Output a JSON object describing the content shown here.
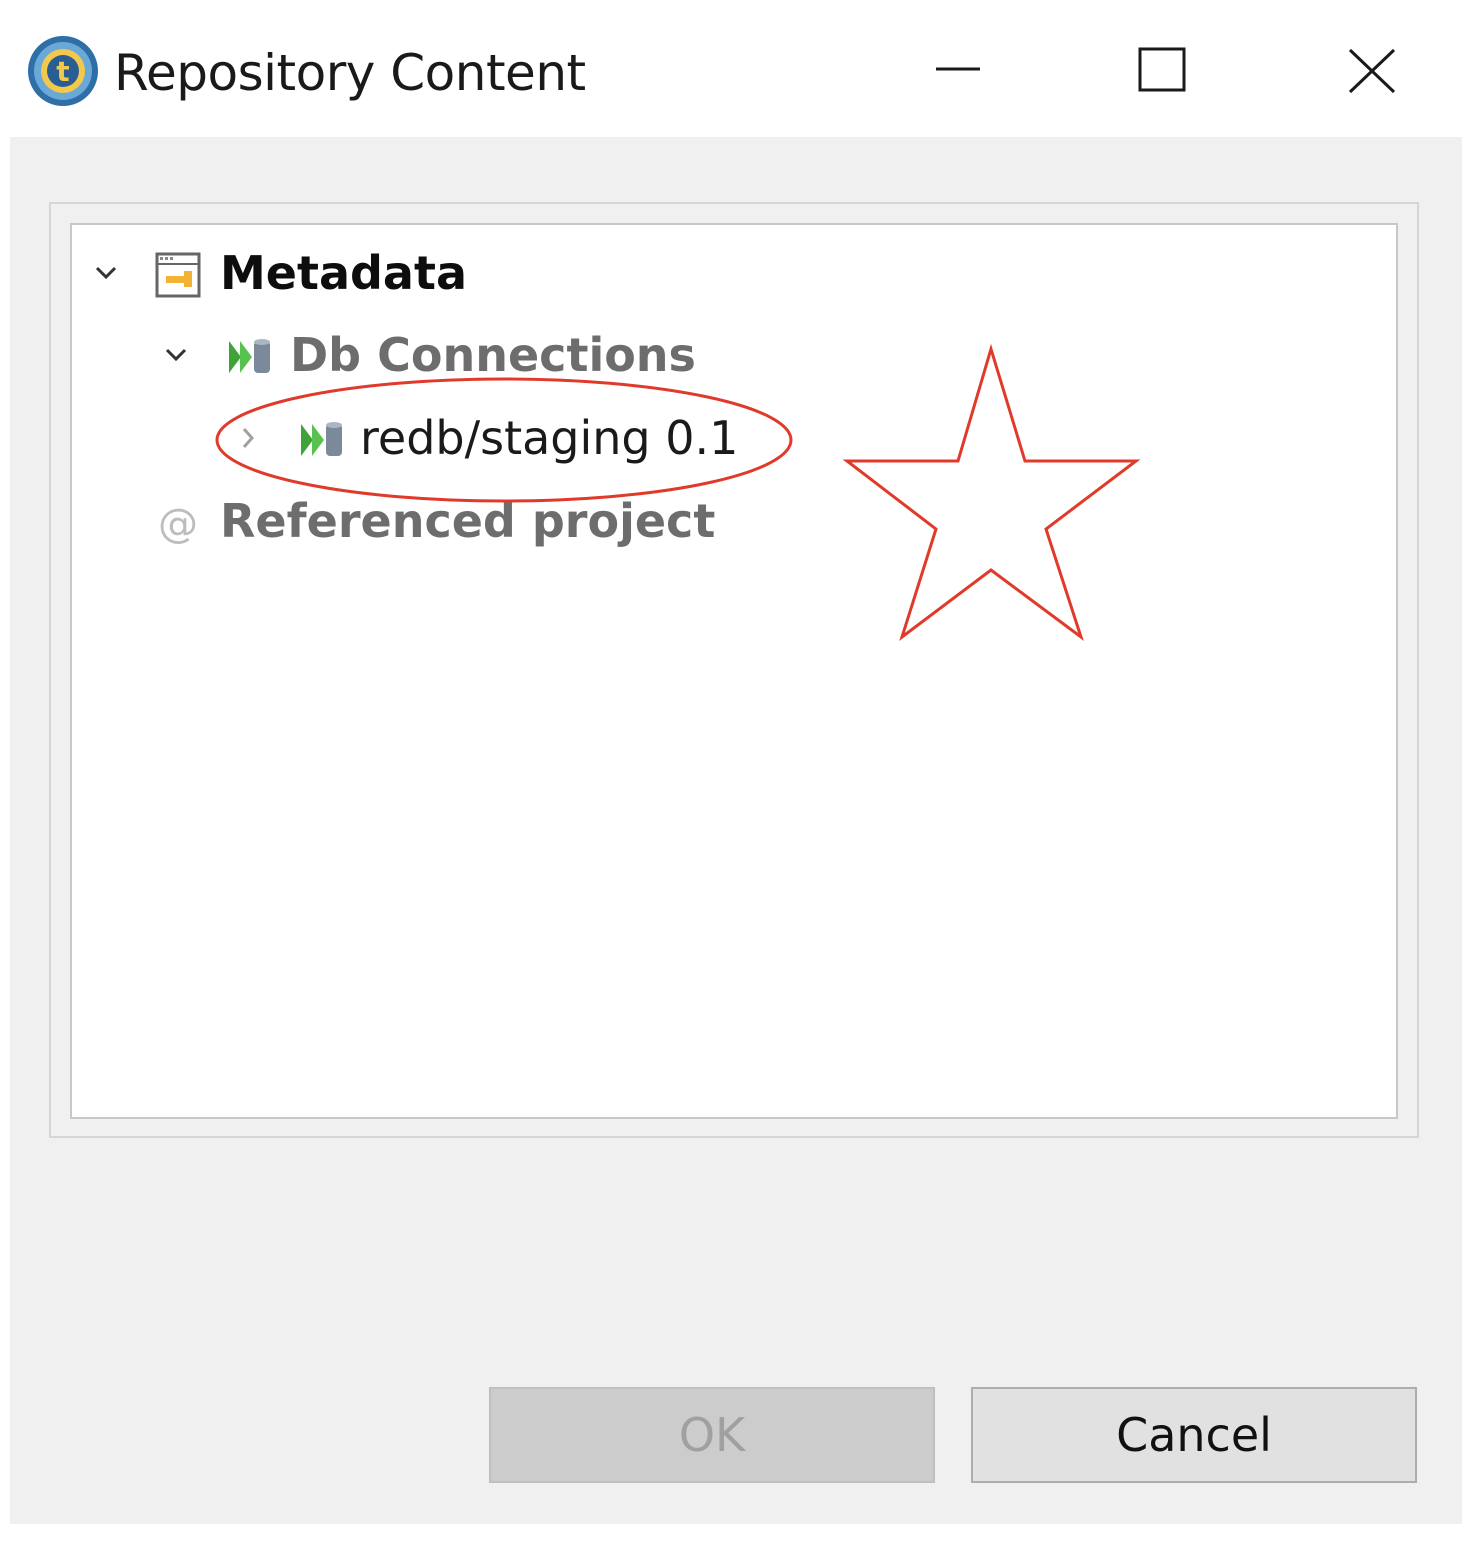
{
  "window": {
    "title": "Repository Content",
    "controls": {
      "minimize": "minimize-icon",
      "maximize": "maximize-icon",
      "close": "close-icon"
    },
    "app_icon": "talend-logo-icon"
  },
  "tree": {
    "items": [
      {
        "label": "Metadata",
        "icon": "metadata-folder-icon",
        "expanded": true,
        "level": 0
      },
      {
        "label": "Db Connections",
        "icon": "db-connection-icon",
        "expanded": true,
        "level": 1
      },
      {
        "label": "redb/staging 0.1",
        "icon": "db-connection-icon",
        "expanded": false,
        "level": 2
      },
      {
        "label": "Referenced project",
        "icon": "at-sign-icon",
        "expanded": null,
        "level": 1
      }
    ]
  },
  "buttons": {
    "ok_label": "OK",
    "ok_enabled": false,
    "cancel_label": "Cancel"
  },
  "annotations": {
    "ellipse_target": "redb/staging 0.1",
    "shape": "star",
    "color": "#e03a2a"
  },
  "colors": {
    "dialog_background": "#f0f0f0",
    "tree_background": "#ffffff",
    "annotation_red": "#e03a2a"
  }
}
